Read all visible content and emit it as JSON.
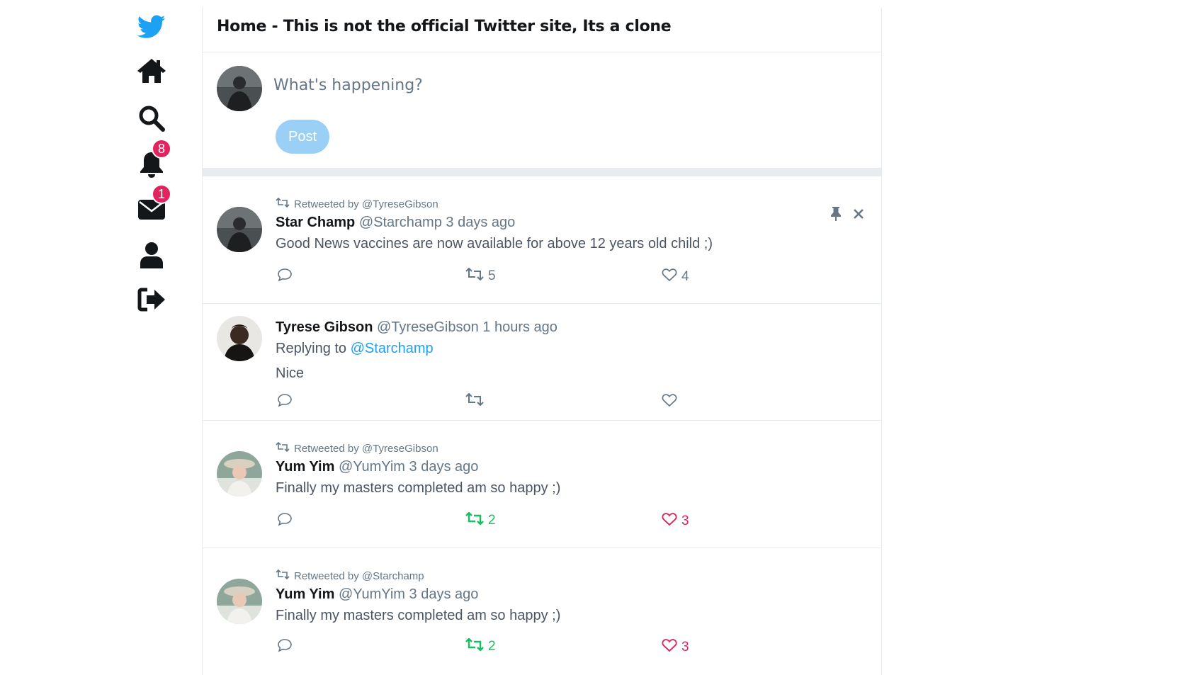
{
  "header": {
    "title": "Home - This is not the official Twitter site, Its a clone"
  },
  "nav": {
    "items": [
      {
        "icon": "twitter-bird-icon",
        "color": "#1da1f2"
      },
      {
        "icon": "home-icon"
      },
      {
        "icon": "search-icon"
      },
      {
        "icon": "bell-icon",
        "badge": "8"
      },
      {
        "icon": "envelope-icon",
        "badge": "1"
      },
      {
        "icon": "user-icon"
      },
      {
        "icon": "logout-icon"
      }
    ]
  },
  "compose": {
    "placeholder": "What's happening?",
    "post_label": "Post"
  },
  "colors": {
    "accent": "#1da1f2",
    "badge": "#e0245e",
    "retweet_active": "#17bf63",
    "like_active": "#e0245e",
    "post_button_disabled": "#9ad0f5"
  },
  "tweets": [
    {
      "retweeted_by": "Retweeted by @TyreseGibson",
      "name": "Star Champ",
      "handle": "@Starchamp",
      "time": "3 days ago",
      "text": "Good News vaccines are now available for above 12 years old child ;)",
      "retweets": "5",
      "likes": "4",
      "retweeted": false,
      "liked": false,
      "controls": [
        "pin-icon",
        "close-icon"
      ]
    },
    {
      "name": "Tyrese Gibson",
      "handle": "@TyreseGibson",
      "time": "1 hours ago",
      "replying_prefix": "Replying to",
      "replying_to": "@Starchamp",
      "text": "Nice",
      "retweets": "",
      "likes": ""
    },
    {
      "retweeted_by": "Retweeted by @TyreseGibson",
      "name": "Yum Yim",
      "handle": "@YumYim",
      "time": "3 days ago",
      "text": "Finally my masters completed am so happy ;)",
      "retweets": "2",
      "likes": "3",
      "retweeted": true,
      "liked": true
    },
    {
      "retweeted_by": "Retweeted by @Starchamp",
      "name": "Yum Yim",
      "handle": "@YumYim",
      "time": "3 days ago",
      "text": "Finally my masters completed am so happy ;)",
      "retweets": "2",
      "likes": "3",
      "retweeted": true,
      "liked": true
    }
  ]
}
